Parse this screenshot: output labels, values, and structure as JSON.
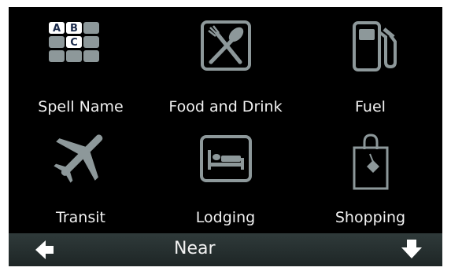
{
  "categories": [
    {
      "label": "Spell Name",
      "icon": "keyboard-icon",
      "tiles": [
        "A",
        "B",
        "C"
      ]
    },
    {
      "label": "Food and Drink",
      "icon": "fork-and-spoon-icon"
    },
    {
      "label": "Fuel",
      "icon": "fuel-pump-icon"
    },
    {
      "label": "Transit",
      "icon": "airplane-icon"
    },
    {
      "label": "Lodging",
      "icon": "bed-icon"
    },
    {
      "label": "Shopping",
      "icon": "shopping-bag-icon"
    }
  ],
  "bottom_bar": {
    "title": "Near",
    "back_icon": "arrow-left-icon",
    "scroll_icon": "arrow-down-icon"
  },
  "colors": {
    "background": "#000000",
    "icon_gray": "#8d989a",
    "label_white": "#f2f2f2",
    "bar": "#263030"
  }
}
